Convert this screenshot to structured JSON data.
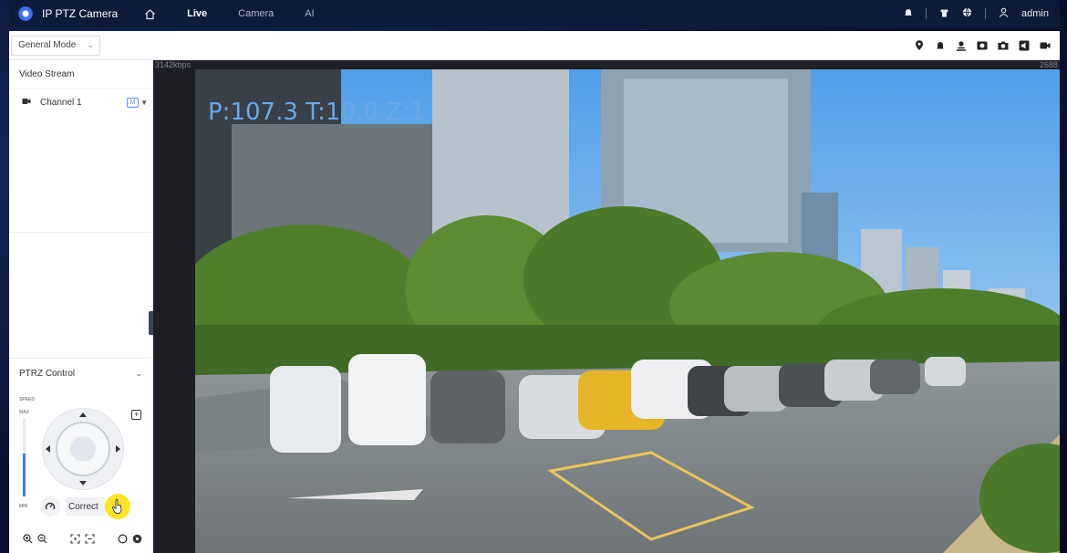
{
  "app": {
    "brand": "IP PTZ Camera",
    "nav": [
      {
        "label": "Live",
        "active": true
      },
      {
        "label": "Camera",
        "active": false
      },
      {
        "label": "AI",
        "active": false
      }
    ],
    "user": "admin"
  },
  "toolbar": {
    "mode": "General Mode",
    "icons": [
      "location-pin-icon",
      "alarm-icon",
      "audio-talk-icon",
      "record-icon",
      "snapshot-icon",
      "audio-icon",
      "video-icon"
    ]
  },
  "left_panel": {
    "video_stream_title": "Video Stream",
    "channel_label": "Channel 1",
    "stream_badge": "M",
    "ptz_title": "PTRZ Control",
    "speed_label": "SPEED",
    "max_label": "MAX",
    "min_label": "MIN",
    "speed_level_percent": 55,
    "correct_label": "Correct"
  },
  "video": {
    "bitrate": "3142kbps",
    "resolution": "2688",
    "osd": "P:107.3 T:10.0 Z:1"
  },
  "colors": {
    "accent": "#3a7cf0",
    "topbar": "#0d1a3a",
    "osd": "#6aa8e8",
    "cursor_highlight": "#ffe100"
  }
}
